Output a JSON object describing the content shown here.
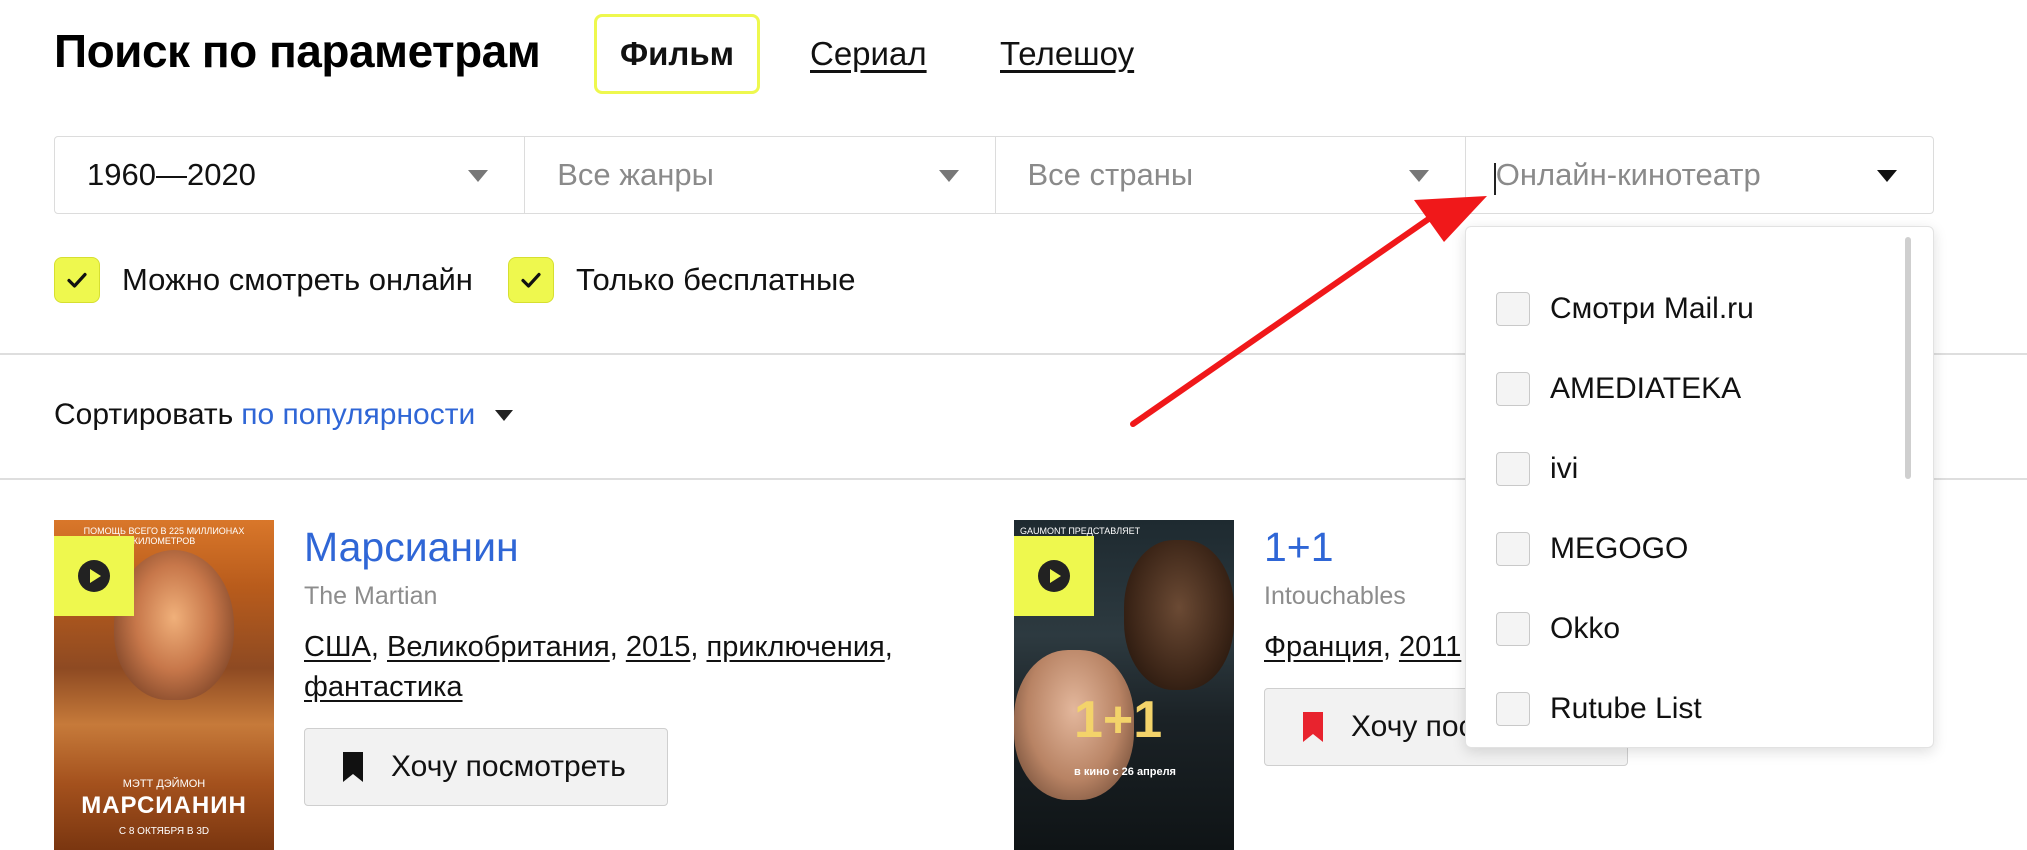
{
  "header": {
    "title": "Поиск по параметрам",
    "tabs": [
      {
        "label": "Фильм",
        "active": true
      },
      {
        "label": "Сериал",
        "active": false
      },
      {
        "label": "Телешоу",
        "active": false
      }
    ]
  },
  "filters": {
    "years": "1960—2020",
    "genres_placeholder": "Все жанры",
    "countries_placeholder": "Все страны",
    "cinema_placeholder": "Онлайн-кинотеатр"
  },
  "checkboxes": [
    {
      "label": "Можно смотреть онлайн",
      "checked": true
    },
    {
      "label": "Только бесплатные",
      "checked": true
    }
  ],
  "sort": {
    "prefix": "Сортировать",
    "value": "по популярности"
  },
  "movies": [
    {
      "title": "Марсианин",
      "original_title": "The Martian",
      "meta_parts": [
        "США",
        "Великобритания",
        "2015",
        "приключения",
        "фантастика"
      ],
      "want_label": "Хочу посмотреть",
      "poster_lines": [
        "МЭТТ ДЭЙМОН",
        "МАРСИАНИН",
        "С 8 ОКТЯБРЯ В 3D"
      ],
      "poster_top_line": "ПОМОЩЬ ВСЕГО В 225 МИЛЛИОНАХ КИЛОМЕТРОВ"
    },
    {
      "title": "1+1",
      "original_title": "Intouchables",
      "meta_parts": [
        "Франция",
        "2011"
      ],
      "want_label": "Хочу посмотреть",
      "poster_lines": [
        "1+1",
        "в кино с 26 апреля"
      ],
      "poster_top_line": "GAUMONT ПРЕДСТАВЛЯЕТ"
    }
  ],
  "cinema_dropdown": {
    "options": [
      "Смотри Mail.ru",
      "AMEDIATEKA",
      "ivi",
      "MEGOGO",
      "Okko",
      "Rutube List"
    ]
  },
  "colors": {
    "accent_yellow": "#eef84e",
    "link_blue": "#2f66d6",
    "annotation_red": "#f0181a",
    "bookmark_red": "#e8232e"
  }
}
